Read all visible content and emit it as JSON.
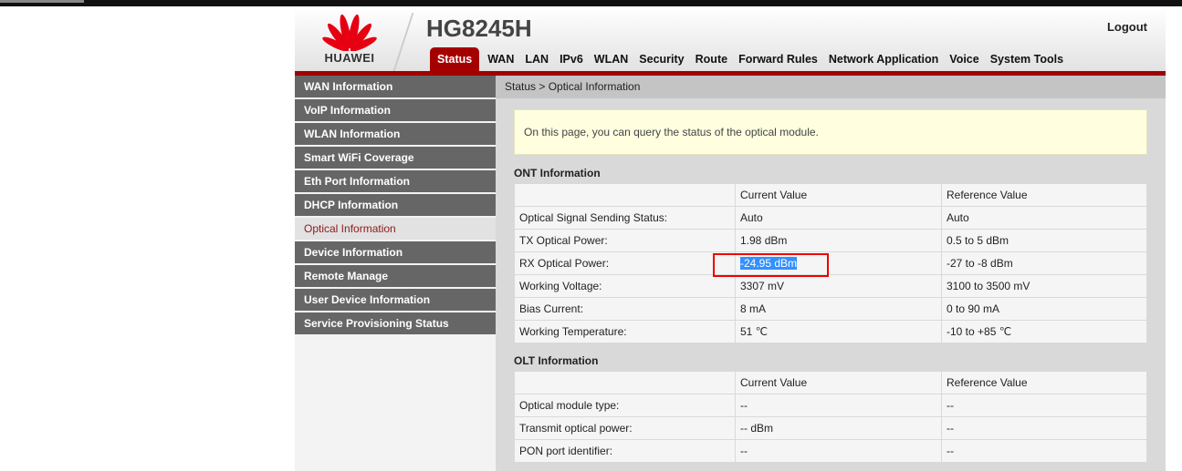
{
  "header": {
    "brand": "HUAWEI",
    "model": "HG8245H",
    "logout": "Logout"
  },
  "nav": [
    "Status",
    "WAN",
    "LAN",
    "IPv6",
    "WLAN",
    "Security",
    "Route",
    "Forward Rules",
    "Network Application",
    "Voice",
    "System Tools"
  ],
  "sidebar": [
    "WAN Information",
    "VoIP Information",
    "WLAN Information",
    "Smart WiFi Coverage",
    "Eth Port Information",
    "DHCP Information",
    "Optical Information",
    "Device Information",
    "Remote Manage",
    "User Device Information",
    "Service Provisioning Status"
  ],
  "breadcrumb": "Status > Optical Information",
  "info": "On this page, you can query the status of the optical module.",
  "ont": {
    "title": "ONT Information",
    "headers": [
      "",
      "Current Value",
      "Reference Value"
    ],
    "rows": [
      [
        "Optical Signal Sending Status:",
        "Auto",
        "Auto"
      ],
      [
        "TX Optical Power:",
        "1.98 dBm",
        "0.5 to 5 dBm"
      ],
      [
        "RX Optical Power:",
        "-24.95 dBm",
        "-27 to -8 dBm"
      ],
      [
        "Working Voltage:",
        "3307 mV",
        "3100 to 3500 mV"
      ],
      [
        "Bias Current:",
        "8 mA",
        "0 to 90 mA"
      ],
      [
        "Working Temperature:",
        "51 ℃",
        "-10 to +85 ℃"
      ]
    ]
  },
  "olt": {
    "title": "OLT Information",
    "headers": [
      "",
      "Current Value",
      "Reference Value"
    ],
    "rows": [
      [
        "Optical module type:",
        "--",
        "--"
      ],
      [
        "Transmit optical power:",
        "-- dBm",
        "--"
      ],
      [
        "PON port identifier:",
        "--",
        "--"
      ]
    ]
  }
}
